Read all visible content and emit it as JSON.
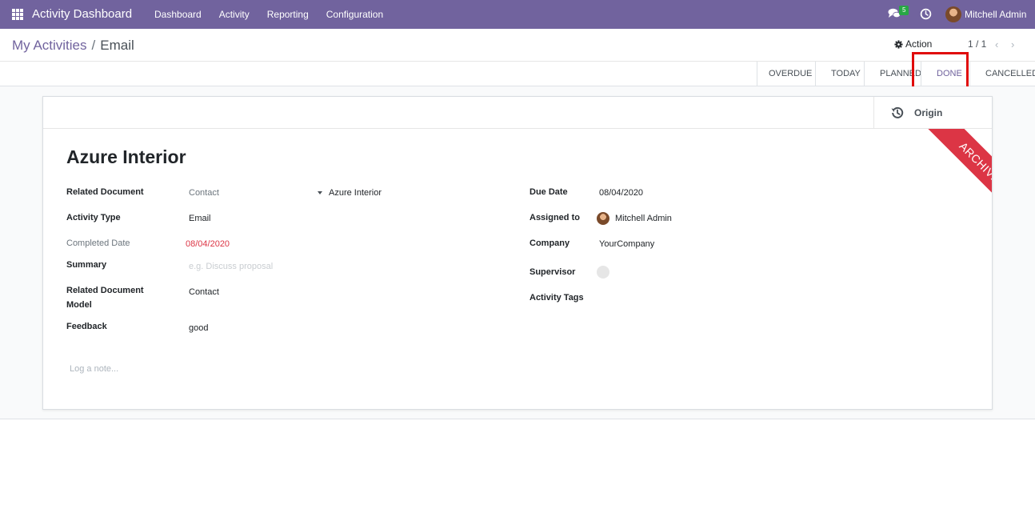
{
  "navbar": {
    "app_title": "Activity Dashboard",
    "menu": [
      "Dashboard",
      "Activity",
      "Reporting",
      "Configuration"
    ],
    "chat_badge": "5",
    "user_name": "Mitchell Admin"
  },
  "control_panel": {
    "breadcrumb_parent": "My Activities",
    "breadcrumb_separator": "/",
    "breadcrumb_current": "Email",
    "action_label": "Action",
    "pager": "1 / 1"
  },
  "statusbar": {
    "stages": [
      "OVERDUE",
      "TODAY",
      "PLANNED",
      "DONE",
      "CANCELLED"
    ],
    "active_stage": "DONE"
  },
  "sheet": {
    "origin_label": "Origin",
    "ribbon": "ARCHIVED",
    "title": "Azure Interior",
    "left_fields": {
      "related_document_label": "Related Document",
      "related_document_model": "Contact",
      "related_document_record": "Azure Interior",
      "activity_type_label": "Activity Type",
      "activity_type_value": "Email",
      "completed_date_label": "Completed Date",
      "completed_date_value": "08/04/2020",
      "summary_label": "Summary",
      "summary_placeholder": "e.g. Discuss proposal",
      "related_document_model_label_1": "Related Document",
      "related_document_model_label_2": "Model",
      "related_document_model_value": "Contact",
      "feedback_label": "Feedback",
      "feedback_value": "good"
    },
    "right_fields": {
      "due_date_label": "Due Date",
      "due_date_value": "08/04/2020",
      "assigned_to_label": "Assigned to",
      "assigned_to_value": "Mitchell Admin",
      "company_label": "Company",
      "company_value": "YourCompany",
      "supervisor_label": "Supervisor",
      "activity_tags_label": "Activity Tags"
    },
    "note_placeholder": "Log a note..."
  },
  "colors": {
    "navbar": "#71639e",
    "accent": "#71639e",
    "danger": "#dc3545",
    "highlight_box": "#e00b0b"
  }
}
